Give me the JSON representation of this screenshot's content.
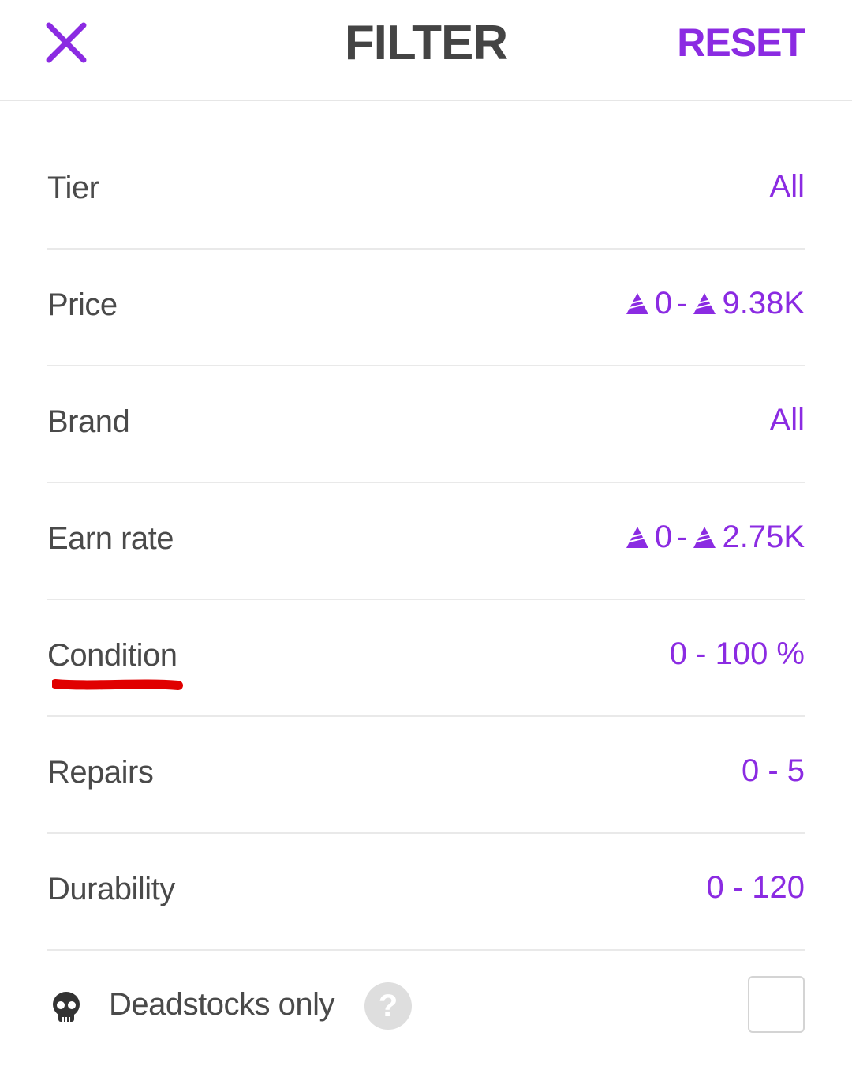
{
  "header": {
    "close_icon": "close-icon",
    "title": "FILTER",
    "reset_label": "RESET"
  },
  "colors": {
    "accent": "#8b2be2",
    "text": "#4a4a4a",
    "divider": "#e9e9e9",
    "annotation": "#e00000"
  },
  "filters": [
    {
      "label": "Tier",
      "value_text": "All"
    },
    {
      "label": "Price",
      "min": "0",
      "max": "9.38K",
      "currency_icon": "coin-icon"
    },
    {
      "label": "Brand",
      "value_text": "All"
    },
    {
      "label": "Earn rate",
      "min": "0",
      "max": "2.75K",
      "currency_icon": "coin-icon"
    },
    {
      "label": "Condition",
      "value_text": "0 - 100 %"
    },
    {
      "label": "Repairs",
      "value_text": "0 - 5"
    },
    {
      "label": "Durability",
      "value_text": "0 - 120"
    }
  ],
  "deadstocks": {
    "icon": "skull-icon",
    "label": "Deadstocks only",
    "help_label": "?",
    "checked": false
  }
}
